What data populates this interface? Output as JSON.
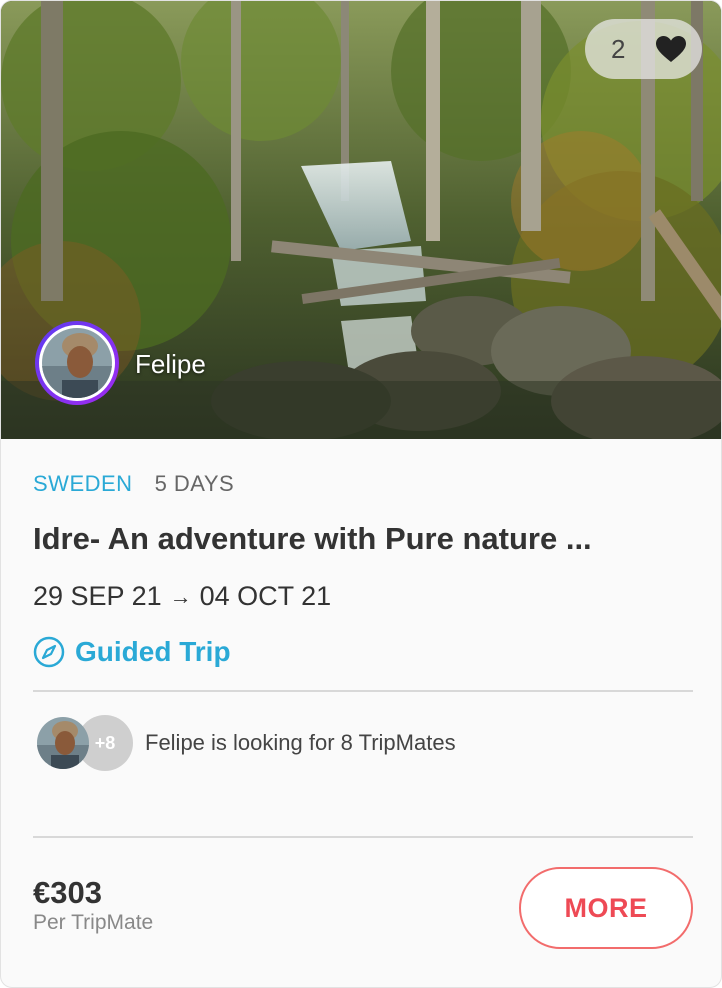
{
  "hero": {
    "like_count": "2",
    "host_name": "Felipe",
    "icons": {
      "like": "heart-icon",
      "avatar": "avatar"
    }
  },
  "trip": {
    "country": "SWEDEN",
    "duration": "5 DAYS",
    "title": "Idre- An adventure with Pure nature ...",
    "start_date": "29 SEP 21",
    "end_date": "04 OCT 21",
    "arrow": "→",
    "trip_type": "Guided Trip",
    "trip_type_icon": "compass-icon"
  },
  "tripmates": {
    "extra_count": "+8",
    "message": "Felipe is looking for 8 TripMates"
  },
  "pricing": {
    "price": "€303",
    "unit": "Per TripMate",
    "button_label": "MORE"
  },
  "colors": {
    "accent_blue": "#2aa9d6",
    "button_red": "#ee4a55",
    "avatar_ring_start": "#5d3cf0",
    "avatar_ring_end": "#a02af0"
  }
}
